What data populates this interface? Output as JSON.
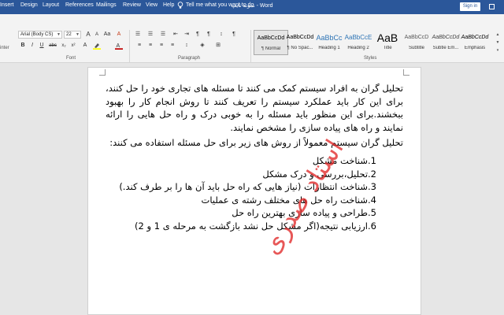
{
  "titlebar": {
    "tabs": [
      "Insert",
      "Design",
      "Layout",
      "References",
      "Mailings",
      "Review",
      "View",
      "Help"
    ],
    "doc_title": "نمونه تایپ  -  Word",
    "tell_me": "Tell me what you want to do",
    "signin": "Sign in"
  },
  "ribbon": {
    "font_name": "Arial (Body CS)",
    "font_size": "22",
    "side_label": "inter",
    "groups": {
      "font": "Font",
      "paragraph": "Paragraph",
      "styles": "Styles"
    },
    "styles": [
      {
        "sample": "AaBbCcDd",
        "name": "¶ Normal"
      },
      {
        "sample": "AaBbCcDd",
        "name": "¶ No Spac..."
      },
      {
        "sample": "AaBbCc",
        "name": "Heading 1"
      },
      {
        "sample": "AaBbCcE",
        "name": "Heading 2"
      },
      {
        "sample": "AaB",
        "name": "Title"
      },
      {
        "sample": "AaBbCcD",
        "name": "Subtitle"
      },
      {
        "sample": "AaBbCcDd",
        "name": "Subtle Em..."
      },
      {
        "sample": "AaBbCcDd",
        "name": "Emphasis"
      }
    ],
    "selected_style": "Normal",
    "font_color": "#c00000",
    "highlight_color": "#ffff00"
  },
  "document": {
    "paragraph1": "تحلیل گران به افراد سیستم کمک می کنند تا مسئله های تجاری خود را حل کنند، برای این کار باید عملکرد سیستم را تعریف کنند تا روش انجام کار را بهبود ببخشند.برای این منظور باید مسئله را به خوبی درک و راه حل هایی را ارائه نمایند و راه های پیاده سازی را مشخص نمایند.",
    "paragraph2": "تحلیل گران سیستم معمولاً از روش های زیر برای حل مسئله استفاده می کنند:",
    "list": [
      "1.شناخت مشکل",
      "2.تحلیل،بررسی و درک مشکل",
      "3.شناخت انتظارات (نیاز هایی که راه حل باید آن ها را بر طرف کند.)",
      "4.شناخت راه حل های مختلف رشته ی عملیات",
      "5.طراحی و پیاده سازی بهترین راه حل",
      "6.ارزیابی نتیجه(اگر مشکل حل نشد بازگشت به مرحله ی 1 و 2)"
    ],
    "watermark": "استاد صدری",
    "watermark_color": "#e12828"
  }
}
